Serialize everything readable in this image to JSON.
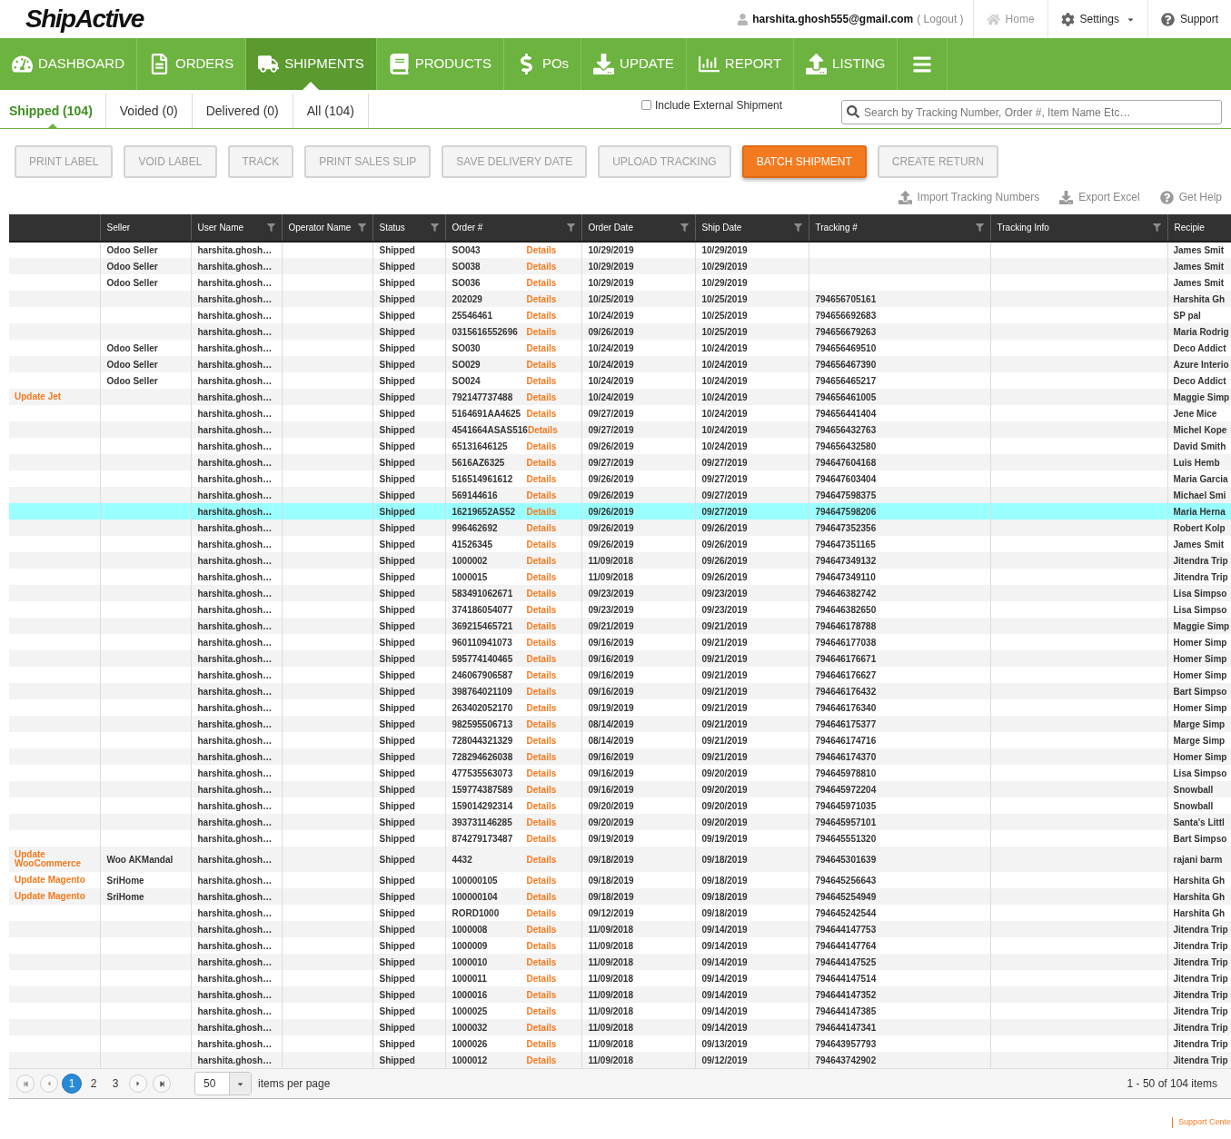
{
  "header": {
    "logo": "ShipActive",
    "user_email": "harshita.ghosh555@gmail.com",
    "logout": "( Logout )",
    "links": [
      {
        "label": "Home",
        "disabled": true,
        "menu": false
      },
      {
        "label": "Settings",
        "disabled": false,
        "menu": true
      },
      {
        "label": "Support",
        "disabled": false,
        "menu": false
      }
    ]
  },
  "nav": [
    {
      "label": "DASHBOARD",
      "selected": false
    },
    {
      "label": "ORDERS",
      "selected": false
    },
    {
      "label": "SHIPMENTS",
      "selected": true
    },
    {
      "label": "PRODUCTS",
      "selected": false
    },
    {
      "label": "POs",
      "selected": false
    },
    {
      "label": "UPDATE",
      "selected": false
    },
    {
      "label": "REPORT",
      "selected": false
    },
    {
      "label": "LISTING",
      "selected": false
    }
  ],
  "tabs": [
    {
      "label": "Shipped (104)",
      "selected": true
    },
    {
      "label": "Voided (0)",
      "selected": false
    },
    {
      "label": "Delivered (0)",
      "selected": false
    },
    {
      "label": "All (104)",
      "selected": false
    }
  ],
  "include_external": {
    "label": "Include External Shipment",
    "checked": false
  },
  "search": {
    "placeholder": "Search by Tracking Number, Order #, Item Name Etc…"
  },
  "actions": [
    {
      "label": "PRINT LABEL",
      "disabled": true
    },
    {
      "label": "VOID LABEL",
      "disabled": true
    },
    {
      "label": "TRACK",
      "disabled": true
    },
    {
      "label": "PRINT SALES SLIP",
      "disabled": true
    },
    {
      "label": "SAVE DELIVERY DATE",
      "disabled": true
    },
    {
      "label": "UPLOAD TRACKING",
      "disabled": true
    },
    {
      "label": "BATCH SHIPMENT",
      "disabled": false
    },
    {
      "label": "CREATE RETURN",
      "disabled": true
    }
  ],
  "tools": [
    "Import Tracking Numbers",
    "Export Excel",
    "Get Help"
  ],
  "table": {
    "columns": [
      {
        "filter": false
      },
      {
        "label": "Seller",
        "filter": false
      },
      {
        "label": "User Name",
        "filter": true
      },
      {
        "label": "Operator Name",
        "filter": true
      },
      {
        "label": "Status",
        "filter": true
      },
      {
        "label": "Order #",
        "filter": true
      },
      {
        "label": "Order Date",
        "filter": true
      },
      {
        "label": "Ship Date",
        "filter": true
      },
      {
        "label": "Tracking #",
        "filter": true
      },
      {
        "label": "Tracking Info",
        "filter": true
      },
      {
        "label": "Recipie",
        "filter": false
      }
    ],
    "rows": [
      {
        "seller": "Odoo Seller",
        "user_name": "harshita.ghosh…",
        "status": "Shipped",
        "order": "SO043",
        "details": "Details",
        "order_date": "10/29/2019",
        "ship_date": "10/29/2019",
        "recipient": "James Smit",
        "selected": false
      },
      {
        "seller": "Odoo Seller",
        "user_name": "harshita.ghosh…",
        "status": "Shipped",
        "order": "SO038",
        "details": "Details",
        "order_date": "10/29/2019",
        "ship_date": "10/29/2019",
        "recipient": "James Smit",
        "selected": false
      },
      {
        "seller": "Odoo Seller",
        "user_name": "harshita.ghosh…",
        "status": "Shipped",
        "order": "SO036",
        "details": "Details",
        "order_date": "10/29/2019",
        "ship_date": "10/29/2019",
        "recipient": "James Smit",
        "selected": false
      },
      {
        "user_name": "harshita.ghosh…",
        "status": "Shipped",
        "order": "202029",
        "details": "Details",
        "order_date": "10/25/2019",
        "ship_date": "10/25/2019",
        "tracking": "794656705161",
        "recipient": "Harshita Gh",
        "selected": false
      },
      {
        "user_name": "harshita.ghosh…",
        "status": "Shipped",
        "order": "25546461",
        "details": "Details",
        "order_date": "10/24/2019",
        "ship_date": "10/25/2019",
        "tracking": "794656692683",
        "recipient": "SP pal",
        "selected": false
      },
      {
        "user_name": "harshita.ghosh…",
        "status": "Shipped",
        "order": "0315616552696",
        "details": "Details",
        "order_date": "09/26/2019",
        "ship_date": "10/25/2019",
        "tracking": "794656679263",
        "recipient": "Maria Rodrig",
        "selected": false
      },
      {
        "seller": "Odoo Seller",
        "user_name": "harshita.ghosh…",
        "status": "Shipped",
        "order": "SO030",
        "details": "Details",
        "order_date": "10/24/2019",
        "ship_date": "10/24/2019",
        "tracking": "794656469510",
        "recipient": "Deco Addict",
        "selected": false
      },
      {
        "seller": "Odoo Seller",
        "user_name": "harshita.ghosh…",
        "status": "Shipped",
        "order": "SO029",
        "details": "Details",
        "order_date": "10/24/2019",
        "ship_date": "10/24/2019",
        "tracking": "794656467390",
        "recipient": "Azure Interio",
        "selected": false
      },
      {
        "seller": "Odoo Seller",
        "user_name": "harshita.ghosh…",
        "status": "Shipped",
        "order": "SO024",
        "details": "Details",
        "order_date": "10/24/2019",
        "ship_date": "10/24/2019",
        "tracking": "794656465217",
        "recipient": "Deco Addict",
        "selected": false
      },
      {
        "column_1": "Update Jet",
        "user_name": "harshita.ghosh…",
        "status": "Shipped",
        "order": "792147737488",
        "details": "Details",
        "order_date": "10/24/2019",
        "ship_date": "10/24/2019",
        "tracking": "794656461005",
        "recipient": "Maggie Simp",
        "selected": false
      },
      {
        "user_name": "harshita.ghosh…",
        "status": "Shipped",
        "order": "5164691AA4625",
        "details": "Details",
        "order_date": "09/27/2019",
        "ship_date": "10/24/2019",
        "tracking": "794656441404",
        "recipient": "Jene Mice",
        "selected": false
      },
      {
        "user_name": "harshita.ghosh…",
        "status": "Shipped",
        "order": "4541664ASAS516",
        "details": "Details",
        "order_date": "09/27/2019",
        "ship_date": "10/24/2019",
        "tracking": "794656432763",
        "recipient": "Michel Kope",
        "selected": false
      },
      {
        "user_name": "harshita.ghosh…",
        "status": "Shipped",
        "order": "65131646125",
        "details": "Details",
        "order_date": "09/26/2019",
        "ship_date": "10/24/2019",
        "tracking": "794656432580",
        "recipient": "David Smith",
        "selected": false
      },
      {
        "user_name": "harshita.ghosh…",
        "status": "Shipped",
        "order": "5616AZ6325",
        "details": "Details",
        "order_date": "09/27/2019",
        "ship_date": "09/27/2019",
        "tracking": "794647604168",
        "recipient": "Luis Hemb",
        "selected": false
      },
      {
        "user_name": "harshita.ghosh…",
        "status": "Shipped",
        "order": "516514961612",
        "details": "Details",
        "order_date": "09/26/2019",
        "ship_date": "09/27/2019",
        "tracking": "794647603404",
        "recipient": "Maria Garcia",
        "selected": false
      },
      {
        "user_name": "harshita.ghosh…",
        "status": "Shipped",
        "order": "569144616",
        "details": "Details",
        "order_date": "09/26/2019",
        "ship_date": "09/27/2019",
        "tracking": "794647598375",
        "recipient": "Michael Smi",
        "selected": false
      },
      {
        "user_name": "harshita.ghosh…",
        "status": "Shipped",
        "order": "16219652AS52",
        "details": "Details",
        "order_date": "09/26/2019",
        "ship_date": "09/27/2019",
        "tracking": "794647598206",
        "recipient": "Maria Herna",
        "selected": true
      },
      {
        "user_name": "harshita.ghosh…",
        "status": "Shipped",
        "order": "996462692",
        "details": "Details",
        "order_date": "09/26/2019",
        "ship_date": "09/26/2019",
        "tracking": "794647352356",
        "recipient": "Robert Kolp",
        "selected": false
      },
      {
        "user_name": "harshita.ghosh…",
        "status": "Shipped",
        "order": "41526345",
        "details": "Details",
        "order_date": "09/26/2019",
        "ship_date": "09/26/2019",
        "tracking": "794647351165",
        "recipient": "James Smit",
        "selected": false
      },
      {
        "user_name": "harshita.ghosh…",
        "status": "Shipped",
        "order": "1000002",
        "details": "Details",
        "order_date": "11/09/2018",
        "ship_date": "09/26/2019",
        "tracking": "794647349132",
        "recipient": "Jitendra Trip",
        "selected": false
      },
      {
        "user_name": "harshita.ghosh…",
        "status": "Shipped",
        "order": "1000015",
        "details": "Details",
        "order_date": "11/09/2018",
        "ship_date": "09/26/2019",
        "tracking": "794647349110",
        "recipient": "Jitendra Trip",
        "selected": false
      },
      {
        "user_name": "harshita.ghosh…",
        "status": "Shipped",
        "order": "583491062671",
        "details": "Details",
        "order_date": "09/23/2019",
        "ship_date": "09/23/2019",
        "tracking": "794646382742",
        "recipient": "Lisa Simpso",
        "selected": false
      },
      {
        "user_name": "harshita.ghosh…",
        "status": "Shipped",
        "order": "374186054077",
        "details": "Details",
        "order_date": "09/23/2019",
        "ship_date": "09/23/2019",
        "tracking": "794646382650",
        "recipient": "Lisa Simpso",
        "selected": false
      },
      {
        "user_name": "harshita.ghosh…",
        "status": "Shipped",
        "order": "369215465721",
        "details": "Details",
        "order_date": "09/21/2019",
        "ship_date": "09/21/2019",
        "tracking": "794646178788",
        "recipient": "Maggie Simp",
        "selected": false
      },
      {
        "user_name": "harshita.ghosh…",
        "status": "Shipped",
        "order": "960110941073",
        "details": "Details",
        "order_date": "09/16/2019",
        "ship_date": "09/21/2019",
        "tracking": "794646177038",
        "recipient": "Homer Simp",
        "selected": false
      },
      {
        "user_name": "harshita.ghosh…",
        "status": "Shipped",
        "order": "595774140465",
        "details": "Details",
        "order_date": "09/16/2019",
        "ship_date": "09/21/2019",
        "tracking": "794646176671",
        "recipient": "Homer Simp",
        "selected": false
      },
      {
        "user_name": "harshita.ghosh…",
        "status": "Shipped",
        "order": "246067906587",
        "details": "Details",
        "order_date": "09/16/2019",
        "ship_date": "09/21/2019",
        "tracking": "794646176627",
        "recipient": "Homer Simp",
        "selected": false
      },
      {
        "user_name": "harshita.ghosh…",
        "status": "Shipped",
        "order": "398764021109",
        "details": "Details",
        "order_date": "09/16/2019",
        "ship_date": "09/21/2019",
        "tracking": "794646176432",
        "recipient": "Bart Simpso",
        "selected": false
      },
      {
        "user_name": "harshita.ghosh…",
        "status": "Shipped",
        "order": "263402052170",
        "details": "Details",
        "order_date": "09/19/2019",
        "ship_date": "09/21/2019",
        "tracking": "794646176340",
        "recipient": "Homer Simp",
        "selected": false
      },
      {
        "user_name": "harshita.ghosh…",
        "status": "Shipped",
        "order": "982595506713",
        "details": "Details",
        "order_date": "08/14/2019",
        "ship_date": "09/21/2019",
        "tracking": "794646175377",
        "recipient": "Marge Simp",
        "selected": false
      },
      {
        "user_name": "harshita.ghosh…",
        "status": "Shipped",
        "order": "728044321329",
        "details": "Details",
        "order_date": "08/14/2019",
        "ship_date": "09/21/2019",
        "tracking": "794646174716",
        "recipient": "Marge Simp",
        "selected": false
      },
      {
        "user_name": "harshita.ghosh…",
        "status": "Shipped",
        "order": "728294626038",
        "details": "Details",
        "order_date": "09/16/2019",
        "ship_date": "09/21/2019",
        "tracking": "794646174370",
        "recipient": "Homer Simp",
        "selected": false
      },
      {
        "user_name": "harshita.ghosh…",
        "status": "Shipped",
        "order": "477535563073",
        "details": "Details",
        "order_date": "09/16/2019",
        "ship_date": "09/20/2019",
        "tracking": "794645978810",
        "recipient": "Lisa Simpso",
        "selected": false
      },
      {
        "user_name": "harshita.ghosh…",
        "status": "Shipped",
        "order": "159774387589",
        "details": "Details",
        "order_date": "09/16/2019",
        "ship_date": "09/20/2019",
        "tracking": "794645972204",
        "recipient": "Snowball",
        "selected": false
      },
      {
        "user_name": "harshita.ghosh…",
        "status": "Shipped",
        "order": "159014292314",
        "details": "Details",
        "order_date": "09/20/2019",
        "ship_date": "09/20/2019",
        "tracking": "794645971035",
        "recipient": "Snowball",
        "selected": false
      },
      {
        "user_name": "harshita.ghosh…",
        "status": "Shipped",
        "order": "393731146285",
        "details": "Details",
        "order_date": "09/20/2019",
        "ship_date": "09/20/2019",
        "tracking": "794645957101",
        "recipient": "Santa's Littl",
        "selected": false
      },
      {
        "user_name": "harshita.ghosh…",
        "status": "Shipped",
        "order": "874279173487",
        "details": "Details",
        "order_date": "09/19/2019",
        "ship_date": "09/19/2019",
        "tracking": "794645551320",
        "recipient": "Bart Simpso",
        "selected": false
      },
      {
        "column_1": "Update WooCommerce",
        "seller": "Woo AKMandal",
        "user_name": "harshita.ghosh…",
        "status": "Shipped",
        "order": "4432",
        "details": "Details",
        "order_date": "09/18/2019",
        "ship_date": "09/18/2019",
        "tracking": "794645301639",
        "recipient": "rajani barm",
        "selected": false
      },
      {
        "column_1": "Update Magento",
        "seller": "SriHome",
        "user_name": "harshita.ghosh…",
        "status": "Shipped",
        "order": "100000105",
        "details": "Details",
        "order_date": "09/18/2019",
        "ship_date": "09/18/2019",
        "tracking": "794645256643",
        "recipient": "Harshita Gh",
        "selected": false
      },
      {
        "column_1": "Update Magento",
        "seller": "SriHome",
        "user_name": "harshita.ghosh…",
        "status": "Shipped",
        "order": "100000104",
        "details": "Details",
        "order_date": "09/18/2019",
        "ship_date": "09/18/2019",
        "tracking": "794645254949",
        "recipient": "Harshita Gh",
        "selected": false
      },
      {
        "user_name": "harshita.ghosh…",
        "status": "Shipped",
        "order": "RORD1000",
        "details": "Details",
        "order_date": "09/12/2019",
        "ship_date": "09/18/2019",
        "tracking": "794645242544",
        "recipient": "Harshita Gh",
        "selected": false
      },
      {
        "user_name": "harshita.ghosh…",
        "status": "Shipped",
        "order": "1000008",
        "details": "Details",
        "order_date": "11/09/2018",
        "ship_date": "09/14/2019",
        "tracking": "794644147753",
        "recipient": "Jitendra Trip",
        "selected": false
      },
      {
        "user_name": "harshita.ghosh…",
        "status": "Shipped",
        "order": "1000009",
        "details": "Details",
        "order_date": "11/09/2018",
        "ship_date": "09/14/2019",
        "tracking": "794644147764",
        "recipient": "Jitendra Trip",
        "selected": false
      },
      {
        "user_name": "harshita.ghosh…",
        "status": "Shipped",
        "order": "1000010",
        "details": "Details",
        "order_date": "11/09/2018",
        "ship_date": "09/14/2019",
        "tracking": "794644147525",
        "recipient": "Jitendra Trip",
        "selected": false
      },
      {
        "user_name": "harshita.ghosh…",
        "status": "Shipped",
        "order": "1000011",
        "details": "Details",
        "order_date": "11/09/2018",
        "ship_date": "09/14/2019",
        "tracking": "794644147514",
        "recipient": "Jitendra Trip",
        "selected": false
      },
      {
        "user_name": "harshita.ghosh…",
        "status": "Shipped",
        "order": "1000016",
        "details": "Details",
        "order_date": "11/09/2018",
        "ship_date": "09/14/2019",
        "tracking": "794644147352",
        "recipient": "Jitendra Trip",
        "selected": false
      },
      {
        "user_name": "harshita.ghosh…",
        "status": "Shipped",
        "order": "1000025",
        "details": "Details",
        "order_date": "11/09/2018",
        "ship_date": "09/14/2019",
        "tracking": "794644147385",
        "recipient": "Jitendra Trip",
        "selected": false
      },
      {
        "user_name": "harshita.ghosh…",
        "status": "Shipped",
        "order": "1000032",
        "details": "Details",
        "order_date": "11/09/2018",
        "ship_date": "09/14/2019",
        "tracking": "794644147341",
        "recipient": "Jitendra Trip",
        "selected": false
      },
      {
        "user_name": "harshita.ghosh…",
        "status": "Shipped",
        "order": "1000026",
        "details": "Details",
        "order_date": "11/09/2018",
        "ship_date": "09/13/2019",
        "tracking": "794643957793",
        "recipient": "Jitendra Trip",
        "selected": false
      },
      {
        "user_name": "harshita.ghosh…",
        "status": "Shipped",
        "order": "1000012",
        "details": "Details",
        "order_date": "11/09/2018",
        "ship_date": "09/12/2019",
        "tracking": "794643742902",
        "recipient": "Jitendra Trip",
        "selected": false
      }
    ]
  },
  "pagination": {
    "pages": [
      {
        "label": "1",
        "selected": true
      },
      {
        "label": "2",
        "selected": false
      },
      {
        "label": "3",
        "selected": false
      }
    ],
    "page_size": "50",
    "page_size_label": "items per page",
    "summary": "1 - 50 of 104 items"
  },
  "footer": {
    "support_link": "Support Cente"
  }
}
